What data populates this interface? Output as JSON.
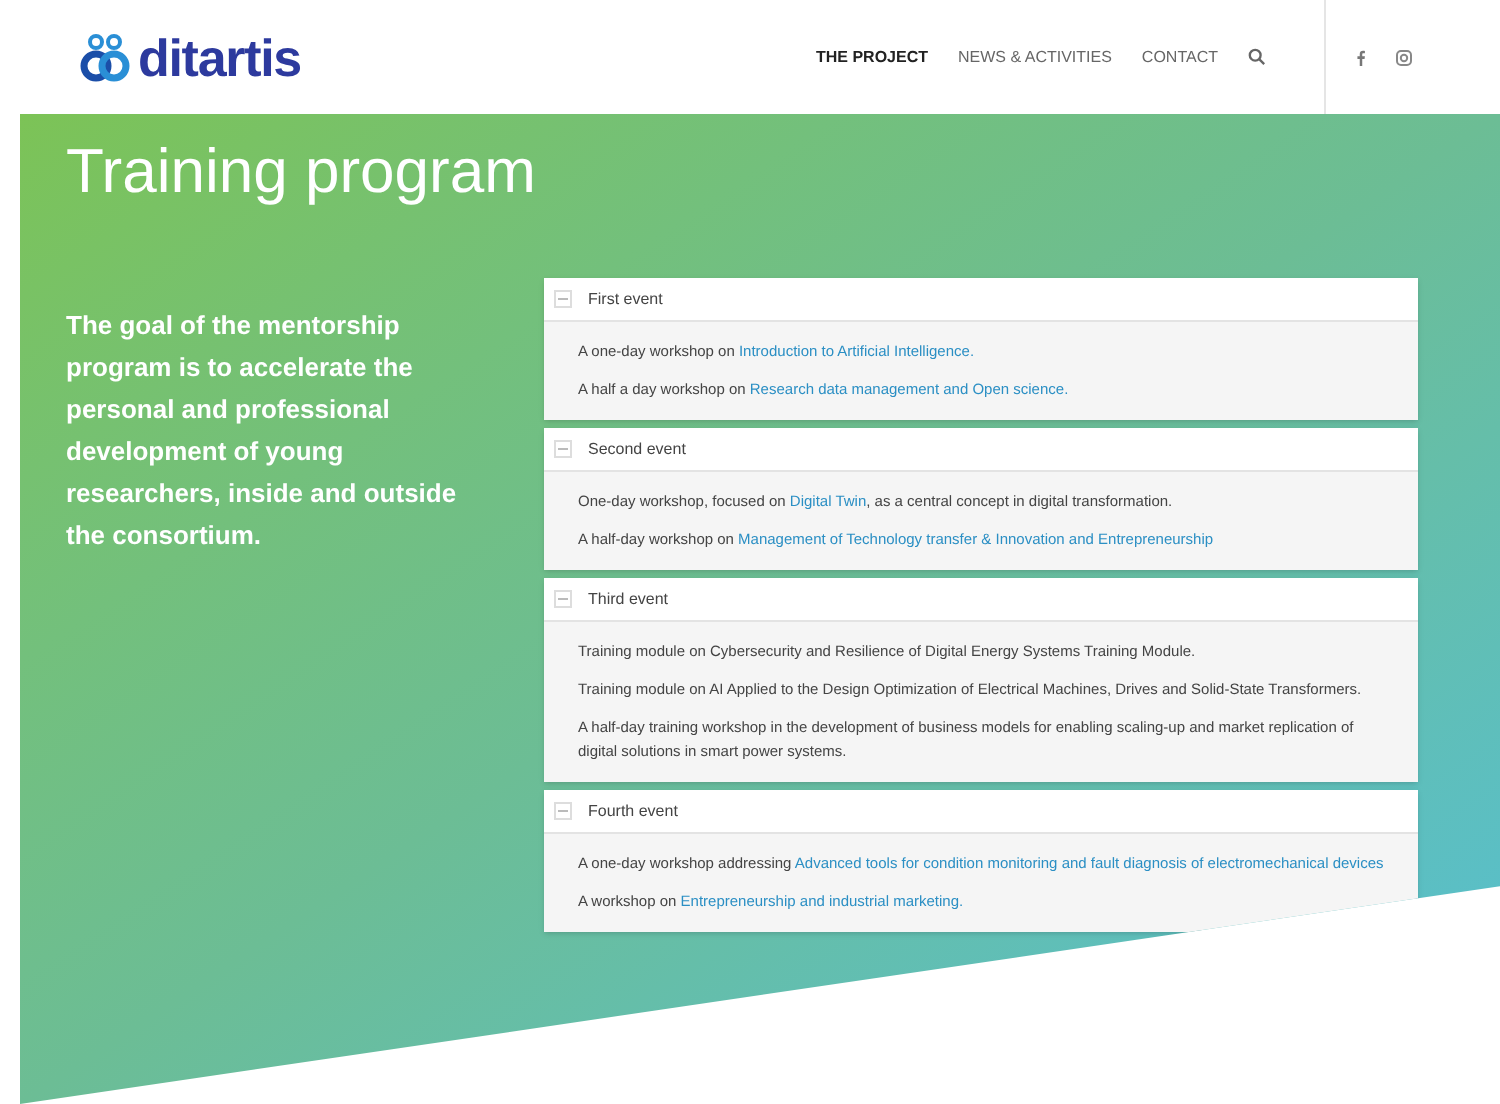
{
  "header": {
    "logo": "ditartis",
    "nav": [
      {
        "label": "THE PROJECT",
        "selected": true
      },
      {
        "label": "NEWS & ACTIVITIES",
        "selected": false
      },
      {
        "label": "CONTACT",
        "selected": false
      }
    ]
  },
  "hero": {
    "title": "Training program",
    "intro": "The goal of the mentorship program is to accelerate the personal and professional development of young researchers, inside and outside the consortium."
  },
  "events": [
    {
      "title": "First event",
      "expanded": true,
      "items": [
        [
          {
            "text": "A one-day workshop on ",
            "link": false
          },
          {
            "text": "Introduction to Artificial Intelligence.",
            "link": true
          }
        ],
        [
          {
            "text": "A half a day workshop on ",
            "link": false
          },
          {
            "text": "Research data management and Open science.",
            "link": true
          }
        ]
      ]
    },
    {
      "title": "Second event",
      "expanded": true,
      "items": [
        [
          {
            "text": "One-day workshop, focused on ",
            "link": false
          },
          {
            "text": "Digital Twin",
            "link": true
          },
          {
            "text": ", as a central concept in digital transformation.",
            "link": false
          }
        ],
        [
          {
            "text": "A half-day workshop on ",
            "link": false
          },
          {
            "text": "Management of Technology transfer & Innovation and Entrepreneurship",
            "link": true
          }
        ]
      ]
    },
    {
      "title": "Third event",
      "expanded": true,
      "items": [
        [
          {
            "text": "Training module on Cybersecurity and Resilience of Digital Energy Systems Training Module.",
            "link": false
          }
        ],
        [
          {
            "text": "Training module on AI Applied to the Design Optimization of Electrical Machines, Drives and Solid-State Transformers.",
            "link": false
          }
        ],
        [
          {
            "text": "A half-day training workshop in the development of business models for enabling scaling-up and market replication of digital solutions in smart power systems.",
            "link": false
          }
        ]
      ]
    },
    {
      "title": "Fourth event",
      "expanded": true,
      "items": [
        [
          {
            "text": "A one-day workshop addressing ",
            "link": false
          },
          {
            "text": "Advanced tools for condition monitoring and fault diagnosis of electromechanical devices",
            "link": true
          }
        ],
        [
          {
            "text": "A workshop on ",
            "link": false
          },
          {
            "text": "Entrepreneurship and industrial marketing.",
            "link": true
          }
        ]
      ]
    }
  ]
}
